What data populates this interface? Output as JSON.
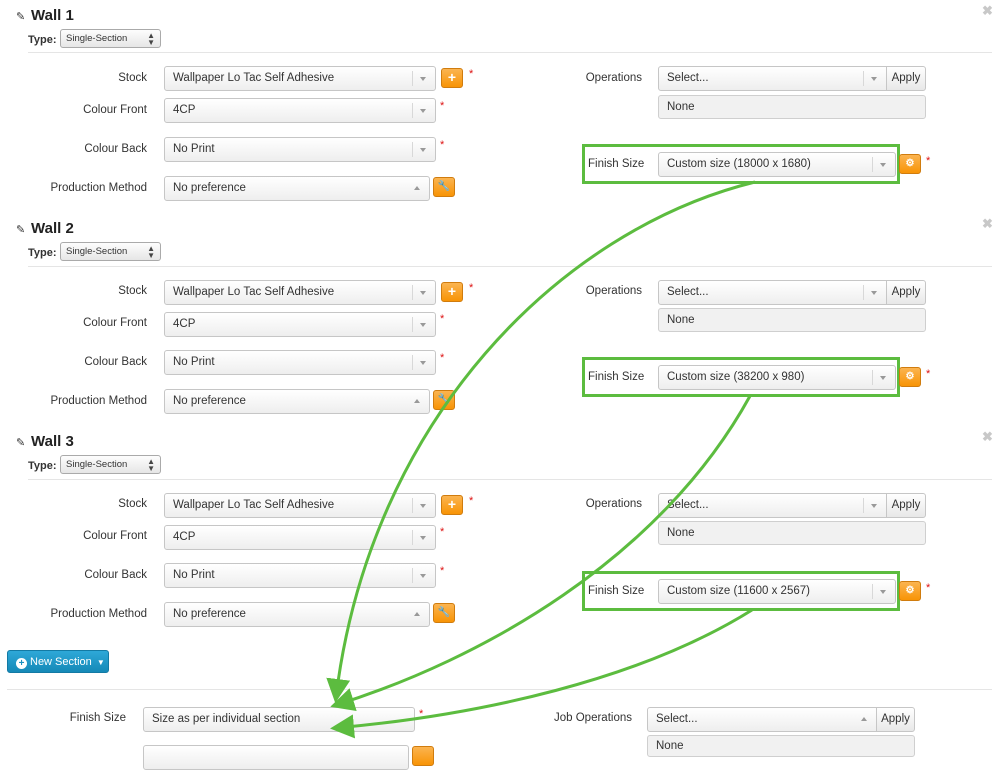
{
  "walls": [
    {
      "title": "Wall 1",
      "type_label": "Type:",
      "type_value": "Single-Section",
      "stock_label": "Stock",
      "stock_value": "Wallpaper Lo Tac Self Adhesive",
      "colour_front_label": "Colour Front",
      "colour_front_value": "4CP",
      "colour_back_label": "Colour Back",
      "colour_back_value": "No Print",
      "production_label": "Production Method",
      "production_value": "No preference",
      "operations_label": "Operations",
      "operations_value": "Select...",
      "apply_label": "Apply",
      "operations_list": "None",
      "finish_label": "Finish Size",
      "finish_value": "Custom size (18000 x 1680)"
    },
    {
      "title": "Wall 2",
      "type_label": "Type:",
      "type_value": "Single-Section",
      "stock_label": "Stock",
      "stock_value": "Wallpaper Lo Tac Self Adhesive",
      "colour_front_label": "Colour Front",
      "colour_front_value": "4CP",
      "colour_back_label": "Colour Back",
      "colour_back_value": "No Print",
      "production_label": "Production Method",
      "production_value": "No preference",
      "operations_label": "Operations",
      "operations_value": "Select...",
      "apply_label": "Apply",
      "operations_list": "None",
      "finish_label": "Finish Size",
      "finish_value": "Custom size (38200 x 980)"
    },
    {
      "title": "Wall 3",
      "type_label": "Type:",
      "type_value": "Single-Section",
      "stock_label": "Stock",
      "stock_value": "Wallpaper Lo Tac Self Adhesive",
      "colour_front_label": "Colour Front",
      "colour_front_value": "4CP",
      "colour_back_label": "Colour Back",
      "colour_back_value": "No Print",
      "production_label": "Production Method",
      "production_value": "No preference",
      "operations_label": "Operations",
      "operations_value": "Select...",
      "apply_label": "Apply",
      "operations_list": "None",
      "finish_label": "Finish Size",
      "finish_value": "Custom size (11600 x 2567)"
    }
  ],
  "new_section_label": "New Section",
  "job": {
    "finish_label": "Finish Size",
    "finish_value": "Size as per individual section",
    "operations_label": "Job Operations",
    "operations_value": "Select...",
    "apply_label": "Apply",
    "operations_list": "None"
  },
  "icons": {
    "edit": "edit-icon",
    "close": "close-icon",
    "add": "plus-icon",
    "wrench": "wrench-icon",
    "gear": "gear-icon",
    "caret": "chevron-down-icon"
  },
  "colors": {
    "highlight": "#5cbc3f",
    "orange_button": "#f89406",
    "primary_button": "#1a90c0",
    "required": "#dd1111"
  }
}
